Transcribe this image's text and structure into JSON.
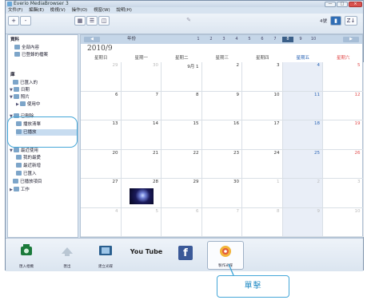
{
  "window": {
    "title": "Everio MediaBrowser 3",
    "minimize": "—",
    "maximize": "□",
    "close": "×"
  },
  "menu": [
    "文件(F)",
    "編輯(E)",
    "檢視(V)",
    "操作(O)",
    "視窗(W)",
    "說明(H)"
  ],
  "toolbar": {
    "add_label": "+",
    "remove_label": "-",
    "edit_label": "✎",
    "view_calendar": "▦",
    "view_list": "☰",
    "view_grid": "◫",
    "level_label": "4號",
    "sort_label": "Z↓"
  },
  "sidebar": {
    "library_heading": "資料",
    "library_all": "全部內容",
    "library_registered": "已登錄的檔案",
    "section_library": "庫",
    "items": [
      "已匯入的",
      "日期",
      "照片",
      "使用中",
      "已刪除",
      "播放清單",
      "已播放",
      "最近使用",
      "我的最愛",
      "最近新增",
      "已匯入",
      "已播放項目",
      "工作"
    ]
  },
  "calendar": {
    "year_label": "年份",
    "month_title": "2010/9",
    "years": [
      "1",
      "2",
      "3",
      "4",
      "5",
      "6",
      "7",
      "8",
      "9",
      "10"
    ],
    "selected_year_index": 7,
    "weekdays": [
      "星期日",
      "星期一",
      "星期二",
      "星期三",
      "星期四",
      "星期五",
      "星期六",
      "星期日"
    ],
    "weeks": [
      [
        "29",
        "30",
        "9月 1",
        "2",
        "3",
        "4",
        "5"
      ],
      [
        "6",
        "7",
        "8",
        "9",
        "10",
        "11",
        "12"
      ],
      [
        "13",
        "14",
        "15",
        "16",
        "17",
        "18",
        "19"
      ],
      [
        "20",
        "21",
        "22",
        "23",
        "24",
        "25",
        "26"
      ],
      [
        "27",
        "28",
        "29",
        "30",
        "1",
        "2",
        "3"
      ],
      [
        "4",
        "5",
        "6",
        "7",
        "8",
        "9",
        "10"
      ]
    ]
  },
  "bottom": {
    "import": "匯入相機",
    "export": "匯出",
    "disc": "建立光碟",
    "youtube": "You Tube",
    "facebook": "f",
    "create": "製作光碟"
  },
  "callout": {
    "text": "單擊"
  },
  "colors": {
    "accent": "#45a7d8",
    "weekend": "#e14d4d",
    "saturday_col": "#e9eef7"
  }
}
